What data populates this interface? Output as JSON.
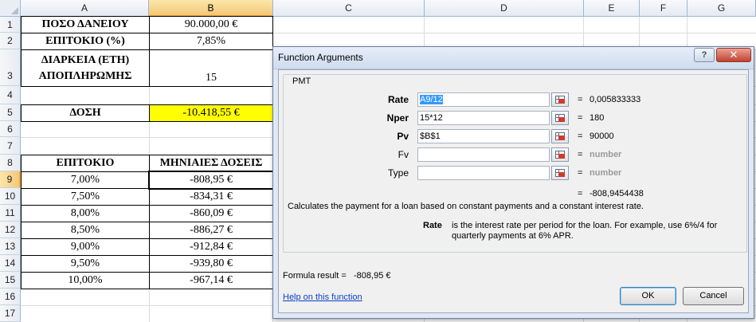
{
  "sheet": {
    "columns": [
      "A",
      "B",
      "C",
      "D",
      "E",
      "F",
      "G"
    ],
    "rows": [
      "1",
      "2",
      "3",
      "4",
      "5",
      "6",
      "7",
      "8",
      "9",
      "10",
      "11",
      "12",
      "13",
      "14",
      "15",
      "16",
      "17"
    ],
    "cells": {
      "a1": "ΠΟΣΟ ΔΑΝΕΙΟΥ",
      "b1": "90.000,00 €",
      "a2": "ΕΠΙΤΟΚΙΟ (%)",
      "b2": "7,85%",
      "a3": "ΔΙΑΡΚΕΙΑ (ΕΤΗ) ΑΠΟΠΛΗΡΩΜΗΣ",
      "b3": "15",
      "a5": "ΔΟΣΗ",
      "b5": "-10.418,55 €",
      "a8": "ΕΠΙΤΟΚΙΟ",
      "b8": "ΜΗΝΙΑΙΕΣ ΔΟΣΕΙΣ"
    },
    "table": [
      {
        "rate": "7,00%",
        "payment": "-808,95 €"
      },
      {
        "rate": "7,50%",
        "payment": "-834,31 €"
      },
      {
        "rate": "8,00%",
        "payment": "-860,09 €"
      },
      {
        "rate": "8,50%",
        "payment": "-886,27 €"
      },
      {
        "rate": "9,00%",
        "payment": "-912,84 €"
      },
      {
        "rate": "9,50%",
        "payment": "-939,80 €"
      },
      {
        "rate": "10,00%",
        "payment": "-967,14 €"
      }
    ],
    "highlight_color": "#ffff00"
  },
  "dialog": {
    "title": "Function Arguments",
    "help_glyph": "?",
    "close_glyph": "✕",
    "function_name": "PMT",
    "args": [
      {
        "label": "Rate",
        "value": "A9/12",
        "result": "0,005833333"
      },
      {
        "label": "Nper",
        "value": "15*12",
        "result": "180"
      },
      {
        "label": "Pv",
        "value": "$B$1",
        "result": "90000"
      },
      {
        "label": "Fv",
        "value": "",
        "result": "number"
      },
      {
        "label": "Type",
        "value": "",
        "result": "number"
      }
    ],
    "eq_sign": "=",
    "function_result": "-808,9454438",
    "description": "Calculates the payment for a loan based on constant payments and a constant interest rate.",
    "arg_help_name": "Rate",
    "arg_help_text": "is the interest rate per period for the loan. For example, use 6%/4 for quarterly payments at 6% APR.",
    "formula_result_label": "Formula result =",
    "formula_result_value": "-808,95 €",
    "help_link": "Help on this function",
    "ok_label": "OK",
    "cancel_label": "Cancel"
  }
}
